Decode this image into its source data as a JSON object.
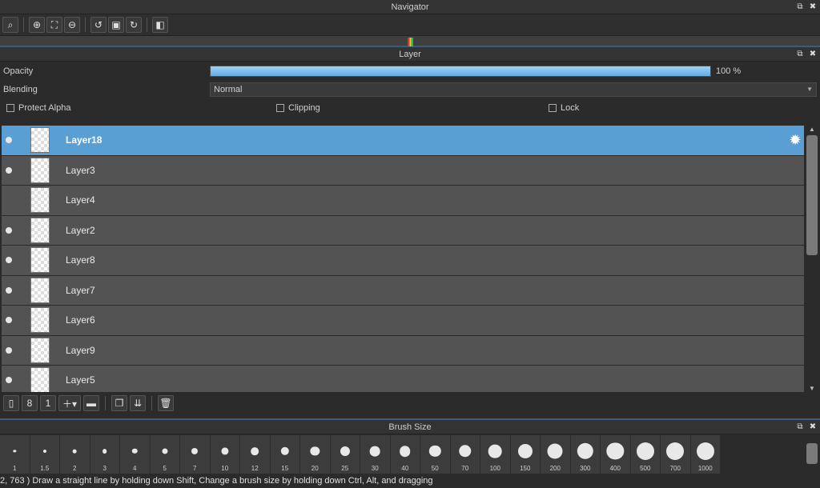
{
  "navigator": {
    "title": "Navigator"
  },
  "layer_panel": {
    "title": "Layer",
    "opacity_label": "Opacity",
    "opacity_value": "100 %",
    "opacity_fraction": 1.0,
    "blending_label": "Blending",
    "blending_value": "Normal",
    "checks": [
      "Protect Alpha",
      "Clipping",
      "Lock"
    ],
    "layers": [
      {
        "name": "Layer18",
        "visible": true,
        "selected": true
      },
      {
        "name": "Layer3",
        "visible": true
      },
      {
        "name": "Layer4",
        "visible": false
      },
      {
        "name": "Layer2",
        "visible": true
      },
      {
        "name": "Layer8",
        "visible": true
      },
      {
        "name": "Layer7",
        "visible": true
      },
      {
        "name": "Layer6",
        "visible": true
      },
      {
        "name": "Layer9",
        "visible": true
      },
      {
        "name": "Layer5",
        "visible": true
      }
    ]
  },
  "brush_panel": {
    "title": "Brush Size",
    "sizes": [
      "1",
      "1.5",
      "2",
      "3",
      "4",
      "5",
      "7",
      "10",
      "12",
      "15",
      "20",
      "25",
      "30",
      "40",
      "50",
      "70",
      "100",
      "150",
      "200",
      "300",
      "400",
      "500",
      "700",
      "1000"
    ]
  },
  "status": {
    "text": "2, 763 )  Draw a straight line by holding down Shift, Change a brush size by holding down Ctrl, Alt, and dragging"
  },
  "colors": {
    "selected": "#5a9fd4",
    "accent": "#3c5c7a"
  }
}
